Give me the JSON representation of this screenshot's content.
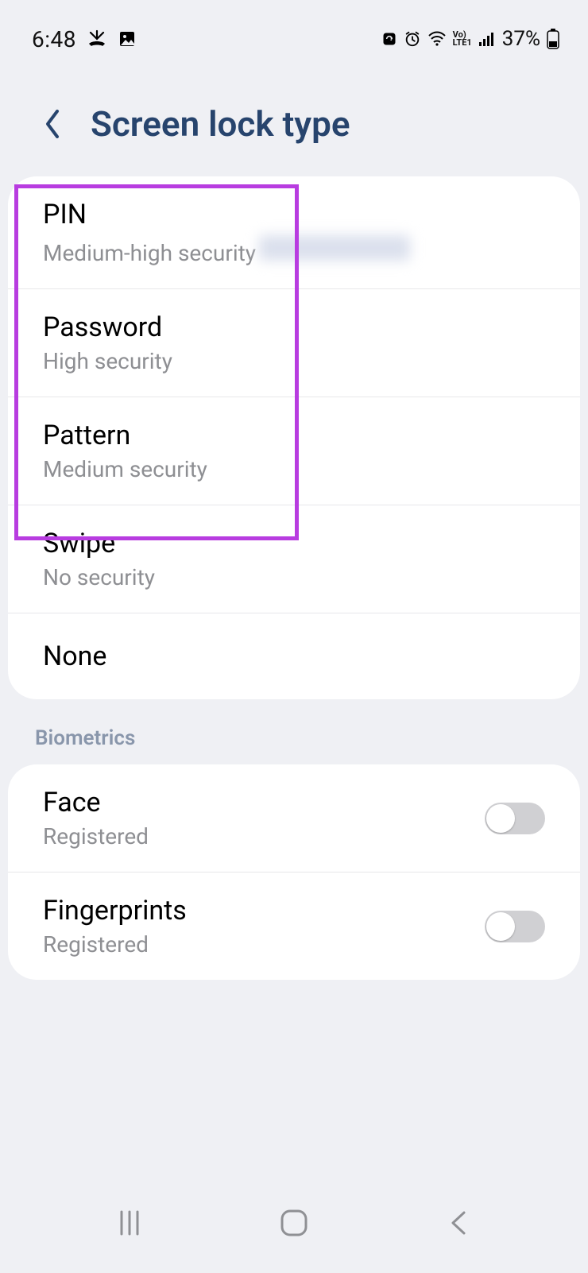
{
  "status": {
    "time": "6:48",
    "battery_text": "37%"
  },
  "header": {
    "title": "Screen lock type"
  },
  "lock_options": {
    "pin": {
      "title": "PIN",
      "sub": "Medium-high security"
    },
    "password": {
      "title": "Password",
      "sub": "High security"
    },
    "pattern": {
      "title": "Pattern",
      "sub": "Medium security"
    },
    "swipe": {
      "title": "Swipe",
      "sub": "No security"
    },
    "none": {
      "title": "None"
    }
  },
  "section": {
    "biometrics": "Biometrics"
  },
  "biometrics": {
    "face": {
      "title": "Face",
      "sub": "Registered",
      "on": false
    },
    "fingerprints": {
      "title": "Fingerprints",
      "sub": "Registered",
      "on": false
    }
  }
}
